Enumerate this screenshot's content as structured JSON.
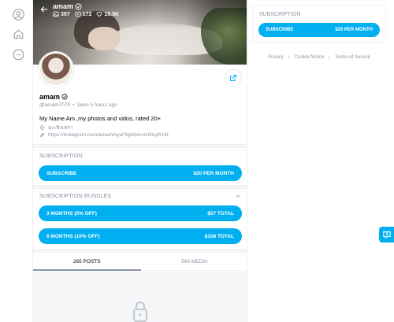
{
  "cover": {
    "name": "amam",
    "stats": {
      "photos": "397",
      "videos": "172",
      "likes": "19.5K"
    }
  },
  "profile": {
    "name": "amam",
    "handle": "@amam7078",
    "meta_sep": "•",
    "last_seen": "Seen  5 hours ago",
    "bio": "My Name Am ,my photos and vidos, rated 20+",
    "location": "ฉะเชิงเทรา",
    "link": "https://instagram.com/amammyw?igshid=ns0iivyfr1fd"
  },
  "subscription": {
    "title": "SUBSCRIPTION",
    "button_label": "SUBSCRIBE",
    "button_price": "$20 per month"
  },
  "bundles": {
    "title": "SUBSCRIPTION BUNDLES",
    "items": [
      {
        "label": "3 MONTHS (5% off)",
        "price": "$57 total"
      },
      {
        "label": "6 MONTHS (10% off)",
        "price": "$108 total"
      }
    ]
  },
  "tabs": [
    {
      "label": "265 POSTS",
      "active": true
    },
    {
      "label": "569 MEDIA",
      "active": false
    }
  ],
  "sidebar": {
    "subscription_title": "SUBSCRIPTION",
    "button_label": "SUBSCRIBE",
    "button_price": "$20 per month",
    "footer": [
      "Privacy",
      "Cookie Notice",
      "Terms of Service"
    ]
  },
  "colors": {
    "accent": "#00aff0",
    "muted_text": "#8a96a3",
    "divider": "#eef1f4"
  },
  "icons": {
    "nav": [
      "user-avatar-icon",
      "home-icon",
      "more-icon"
    ],
    "help": "help-question-icon"
  }
}
